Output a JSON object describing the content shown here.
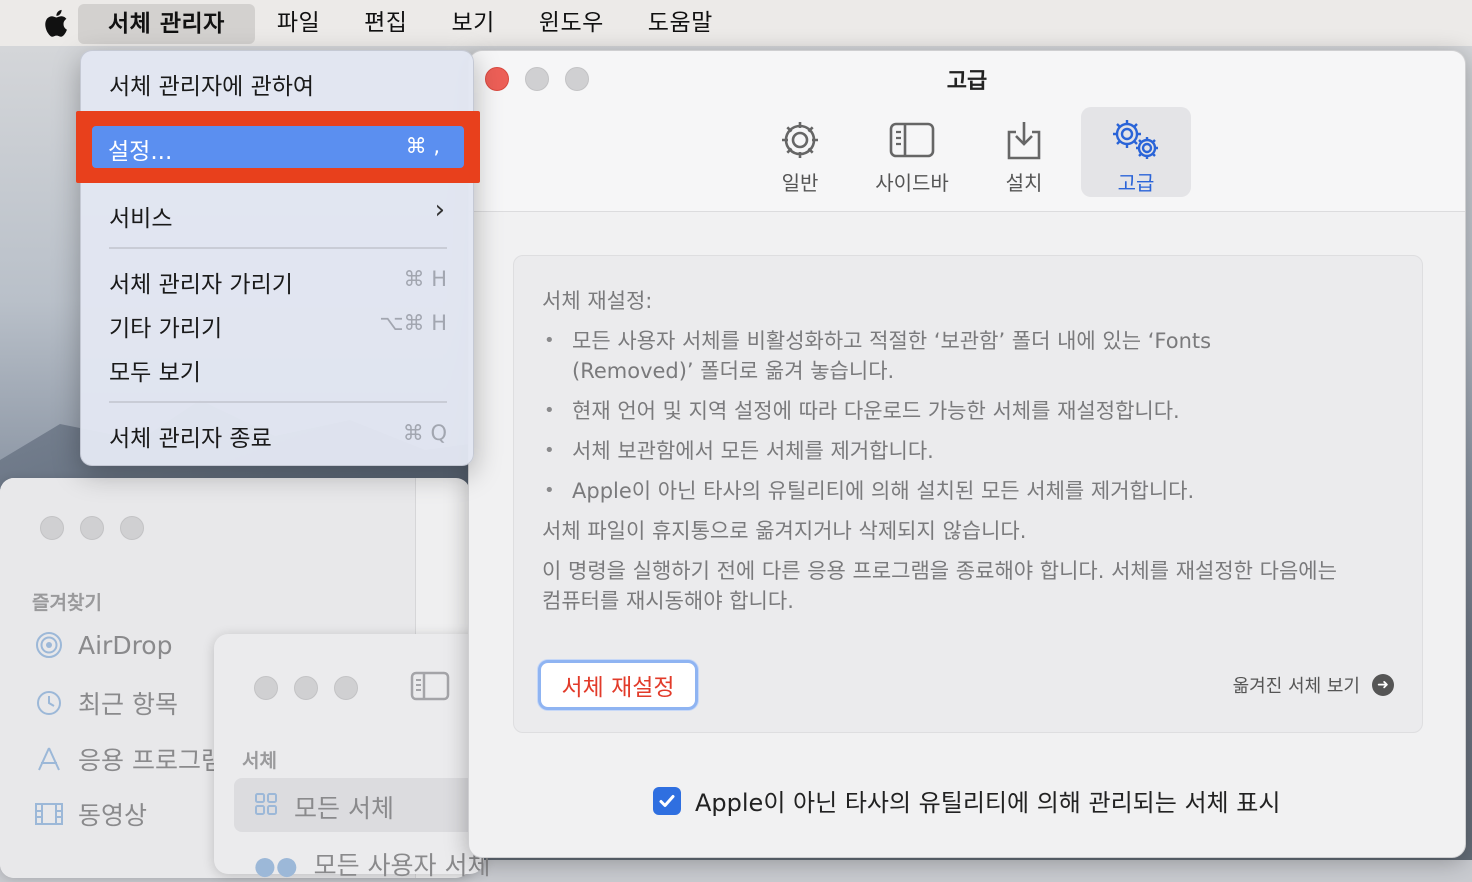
{
  "menubar": {
    "apple_icon": "apple-logo-icon",
    "items": [
      "서체 관리자",
      "파일",
      "편집",
      "보기",
      "윈도우",
      "도움말"
    ]
  },
  "app_menu": {
    "about": "서체 관리자에 관하여",
    "settings": {
      "label": "설정...",
      "shortcut": "⌘ ,"
    },
    "services": {
      "label": "서비스",
      "arrow": "›"
    },
    "hide": {
      "label": "서체 관리자 가리기",
      "shortcut": "⌘ H"
    },
    "hide_others": {
      "label": "기타 가리기",
      "shortcut": "⌥⌘ H"
    },
    "show_all": "모두 보기",
    "quit": {
      "label": "서체 관리자 종료",
      "shortcut": "⌘ Q"
    }
  },
  "settings_window": {
    "title": "고급",
    "tabs": [
      {
        "label": "일반",
        "icon": "gear-icon"
      },
      {
        "label": "사이드바",
        "icon": "sidebar-icon"
      },
      {
        "label": "설치",
        "icon": "download-tray-icon"
      },
      {
        "label": "고급",
        "icon": "gears-icon"
      }
    ],
    "selected_tab": "고급",
    "panel": {
      "heading": "서체 재설정:",
      "bullets": [
        "모든 사용자 서체를 비활성화하고 적절한 ‘보관함’ 폴더 내에 있는 ‘Fonts",
        "(Removed)’ 폴더로 옮겨 놓습니다.",
        "현재 언어 및 지역 설정에 따라 다운로드 가능한 서체를 재설정합니다.",
        "서체 보관함에서 모든 서체를 제거합니다.",
        "Apple이 아닌 타사의 유틸리티에 의해 설치된 모든 서체를 제거합니다."
      ],
      "note1": "서체 파일이 휴지통으로 옮겨지거나 삭제되지 않습니다.",
      "note2_line1": "이 명령을 실행하기 전에 다른 응용 프로그램을 종료해야 합니다. 서체를 재설정한 다음에는",
      "note2_line2": "컴퓨터를 재시동해야 합니다.",
      "reset_button": "서체 재설정",
      "view_removed": "옮겨진 서체 보기"
    },
    "checkbox_label": "Apple이 아닌 타사의 유틸리티에 의해 관리되는 서체 표시",
    "checkbox_checked": true
  },
  "finder_window": {
    "section": "즐겨찾기",
    "items": [
      {
        "label": "AirDrop",
        "icon": "airdrop-icon"
      },
      {
        "label": "최근 항목",
        "icon": "clock-icon"
      },
      {
        "label": "응용 프로그램",
        "icon": "applications-icon"
      },
      {
        "label": "동영상",
        "icon": "film-icon"
      }
    ]
  },
  "fontbook_window": {
    "section": "서체",
    "items": [
      "모든 서체",
      "모든 사용자 서체"
    ]
  },
  "colors": {
    "highlight_red": "#e8401c",
    "menu_selection": "#5b8ff0",
    "accent_blue": "#2a64d8",
    "destructive_red": "#e23b2a",
    "close_red": "#ec5f57"
  }
}
